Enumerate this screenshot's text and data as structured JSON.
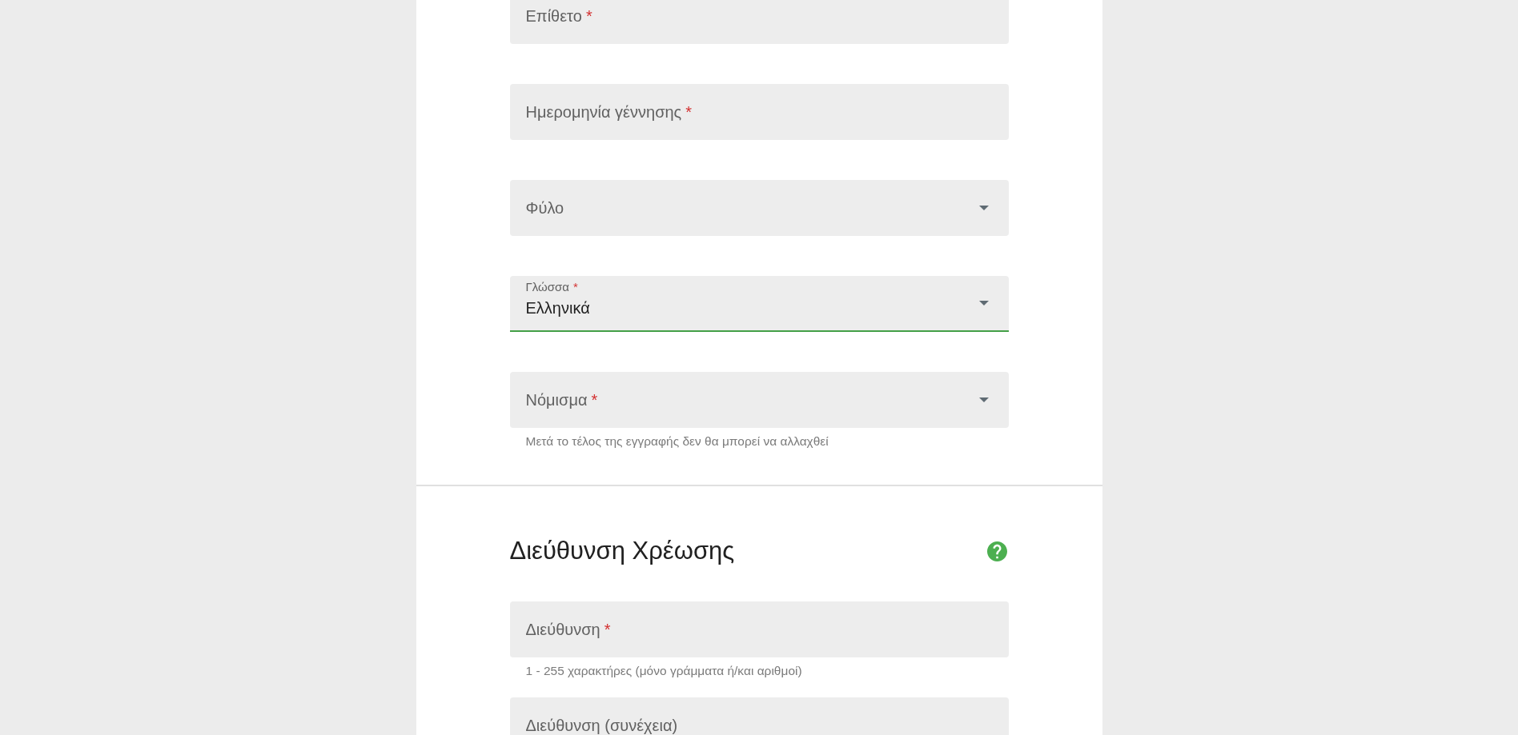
{
  "personal_section": {
    "fields": [
      {
        "kind": "text",
        "label": "Επίθετο",
        "required_mark": "*",
        "focused": false
      },
      {
        "kind": "text",
        "label": "Ημερομηνία γέννησης",
        "required_mark": "*",
        "focused": false
      },
      {
        "kind": "select",
        "label": "Φύλο",
        "focused": false
      },
      {
        "kind": "select",
        "label": "Γλώσσα",
        "required_mark": "*",
        "value": "Ελληνικά",
        "focused": true
      },
      {
        "kind": "select",
        "label": "Νόμισμα",
        "required_mark": "*",
        "focused": false,
        "hint": "Μετά το τέλος της εγγραφής δεν θα μπορεί να αλλαχθεί"
      }
    ]
  },
  "billing_section": {
    "title": "Διεύθυνση Χρέωσης",
    "fields": [
      {
        "kind": "text",
        "label": "Διεύθυνση",
        "required_mark": "*",
        "focused": false,
        "hint": "1 - 255 χαρακτήρες (μόνο γράμματα ή/και αριθμοί)"
      },
      {
        "kind": "text",
        "label": "Διεύθυνση (συνέχεια)",
        "focused": false
      }
    ]
  }
}
